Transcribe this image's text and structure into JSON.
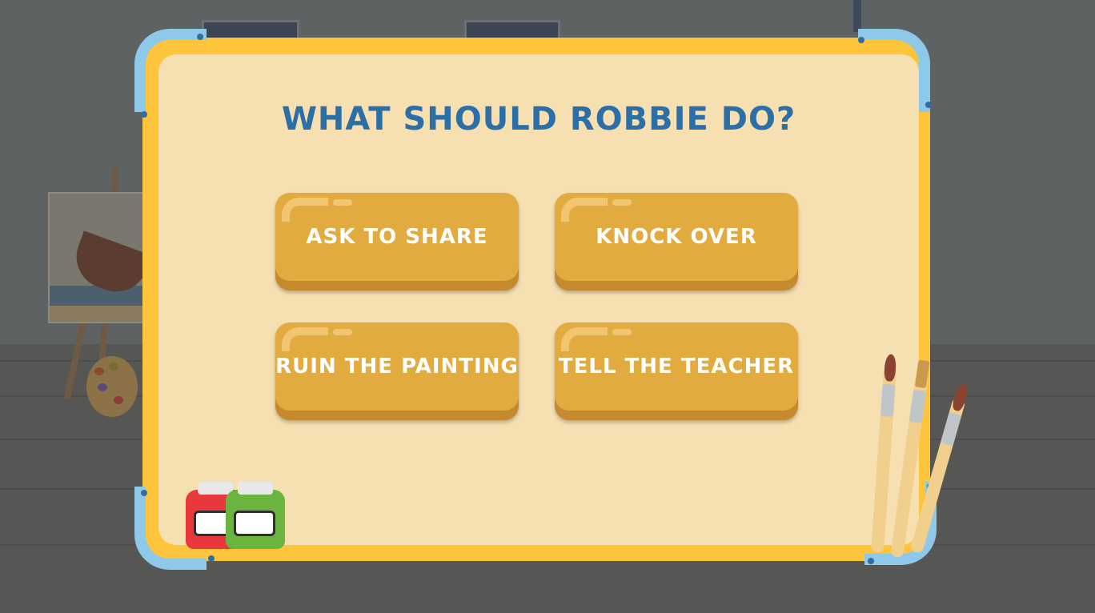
{
  "title": "WHAT SHOULD ROBBIE DO?",
  "choices": [
    {
      "label": "ASK TO SHARE"
    },
    {
      "label": "KNOCK OVER"
    },
    {
      "label": "RUIN THE PAINTING"
    },
    {
      "label": "TELL THE TEACHER"
    }
  ],
  "colors": {
    "board_frame": "#fdc43c",
    "board_surface": "#f6e0b2",
    "corner_guard": "#8fc9ea",
    "title_text": "#2c6ea6",
    "button": "#e2ab40",
    "button_text": "#ffffff"
  },
  "decorations": {
    "paint_jars": [
      "red",
      "green"
    ],
    "brushes": 3
  }
}
